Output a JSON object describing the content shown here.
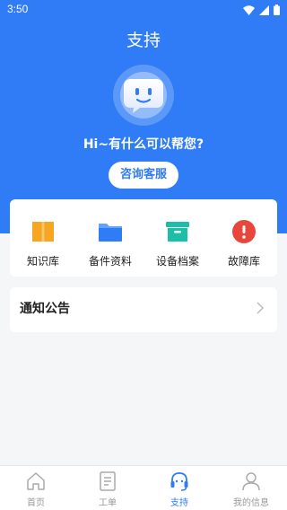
{
  "status_bar": {
    "time": "3:50"
  },
  "header": {
    "title": "支持"
  },
  "hero": {
    "greeting": "Hi~有什么可以帮您?",
    "consult_button": "咨询客服"
  },
  "quick_links": [
    {
      "label": "知识库",
      "icon": "book-icon",
      "color": "#f6a623"
    },
    {
      "label": "备件资料",
      "icon": "folder-icon",
      "color": "#2f7cf6"
    },
    {
      "label": "设备档案",
      "icon": "archive-box-icon",
      "color": "#1bbfa8"
    },
    {
      "label": "故障库",
      "icon": "alert-icon",
      "color": "#e8453c"
    }
  ],
  "notice": {
    "title": "通知公告"
  },
  "tabbar": {
    "items": [
      {
        "label": "首页",
        "icon": "home-icon"
      },
      {
        "label": "工单",
        "icon": "document-icon"
      },
      {
        "label": "支持",
        "icon": "headset-icon",
        "active": true
      },
      {
        "label": "我的信息",
        "icon": "user-icon"
      }
    ]
  },
  "colors": {
    "primary": "#2f7cf6",
    "background": "#f5f6f8"
  }
}
